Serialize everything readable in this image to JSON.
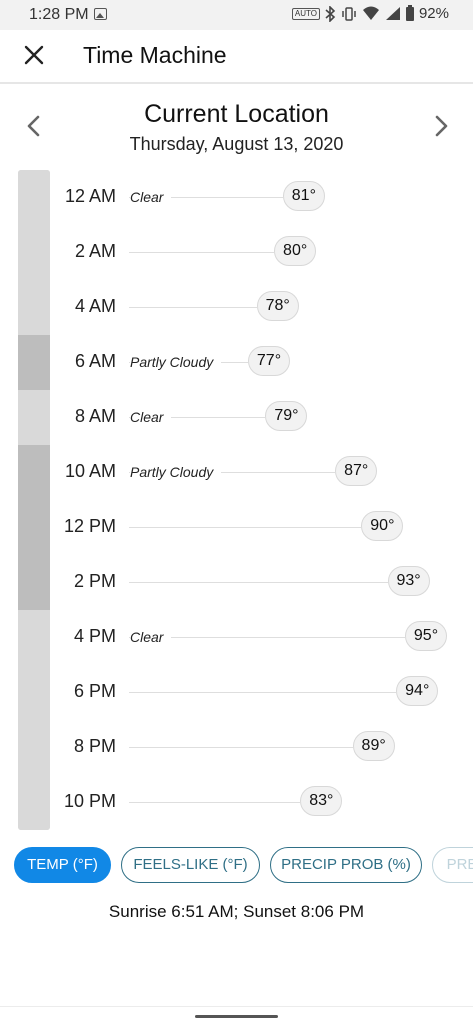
{
  "status_bar": {
    "time": "1:28 PM",
    "auto_badge": "AUTO",
    "battery": "92%"
  },
  "header": {
    "title": "Time Machine",
    "close_icon": "close-icon"
  },
  "location": {
    "title": "Current Location",
    "date": "Thursday, August 13, 2020"
  },
  "hours": [
    {
      "time": "12 AM",
      "condition": "Clear",
      "temp": "81°",
      "temp_value": 81
    },
    {
      "time": "2 AM",
      "condition": "",
      "temp": "80°",
      "temp_value": 80
    },
    {
      "time": "4 AM",
      "condition": "",
      "temp": "78°",
      "temp_value": 78
    },
    {
      "time": "6 AM",
      "condition": "Partly Cloudy",
      "temp": "77°",
      "temp_value": 77
    },
    {
      "time": "8 AM",
      "condition": "Clear",
      "temp": "79°",
      "temp_value": 79
    },
    {
      "time": "10 AM",
      "condition": "Partly Cloudy",
      "temp": "87°",
      "temp_value": 87
    },
    {
      "time": "12 PM",
      "condition": "",
      "temp": "90°",
      "temp_value": 90
    },
    {
      "time": "2 PM",
      "condition": "",
      "temp": "93°",
      "temp_value": 93
    },
    {
      "time": "4 PM",
      "condition": "Clear",
      "temp": "95°",
      "temp_value": 95
    },
    {
      "time": "6 PM",
      "condition": "",
      "temp": "94°",
      "temp_value": 94
    },
    {
      "time": "8 PM",
      "condition": "",
      "temp": "89°",
      "temp_value": 89
    },
    {
      "time": "10 PM",
      "condition": "",
      "temp": "83°",
      "temp_value": 83
    }
  ],
  "condition_bar": [
    {
      "condition": "Clear",
      "hours": 6,
      "color": "#d9d9d9"
    },
    {
      "condition": "Partly Cloudy",
      "hours": 2,
      "color": "#bdbdbd"
    },
    {
      "condition": "Clear",
      "hours": 2,
      "color": "#d9d9d9"
    },
    {
      "condition": "Partly Cloudy",
      "hours": 6,
      "color": "#bdbdbd"
    },
    {
      "condition": "Clear",
      "hours": 8,
      "color": "#d9d9d9"
    }
  ],
  "chips": [
    {
      "label": "TEMP (°F)",
      "active": true
    },
    {
      "label": "FEELS-LIKE (°F)",
      "active": false
    },
    {
      "label": "PRECIP PROB (%)",
      "active": false
    },
    {
      "label": "PRE",
      "active": false
    }
  ],
  "sun_info": "Sunrise 6:51 AM; Sunset 8:06 PM",
  "colors": {
    "accent": "#1188e6",
    "chip_outline": "#2f6f86"
  }
}
